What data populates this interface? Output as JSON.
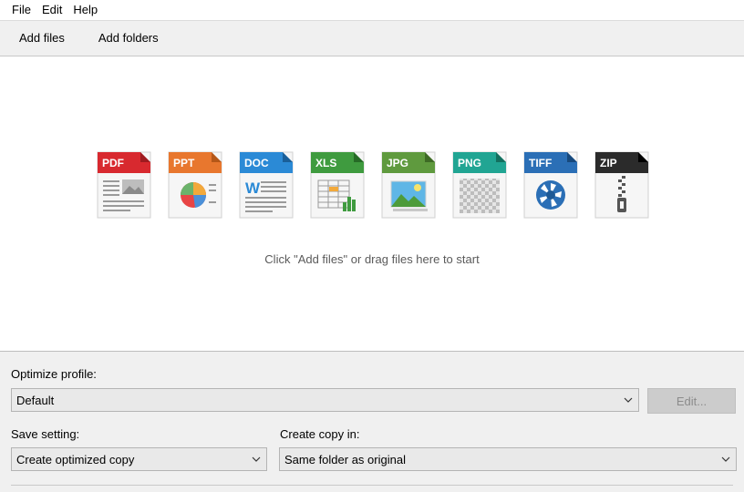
{
  "menu": {
    "items": [
      {
        "label": "File"
      },
      {
        "label": "Edit"
      },
      {
        "label": "Help"
      }
    ]
  },
  "toolbar": {
    "add_files": "Add files",
    "add_folders": "Add folders"
  },
  "dropzone": {
    "hint": "Click \"Add files\" or drag files here to start",
    "file_types": [
      {
        "label": "PDF",
        "color": "#d8292f",
        "icon": "pdf-file-icon"
      },
      {
        "label": "PPT",
        "color": "#e8772e",
        "icon": "ppt-file-icon"
      },
      {
        "label": "DOC",
        "color": "#2b8ad6",
        "icon": "doc-file-icon"
      },
      {
        "label": "XLS",
        "color": "#3f9b3f",
        "icon": "xls-file-icon"
      },
      {
        "label": "JPG",
        "color": "#5f9a3e",
        "icon": "jpg-file-icon"
      },
      {
        "label": "PNG",
        "color": "#21a593",
        "icon": "png-file-icon"
      },
      {
        "label": "TIFF",
        "color": "#2b6fb6",
        "icon": "tiff-file-icon"
      },
      {
        "label": "ZIP",
        "color": "#2b2b2b",
        "icon": "zip-file-icon"
      }
    ],
    "doc_glyph": "W"
  },
  "profile": {
    "label": "Optimize profile:",
    "value": "Default",
    "edit_label": "Edit..."
  },
  "save": {
    "label": "Save setting:",
    "value": "Create optimized copy"
  },
  "copy": {
    "label": "Create copy in:",
    "value": "Same folder as original"
  }
}
